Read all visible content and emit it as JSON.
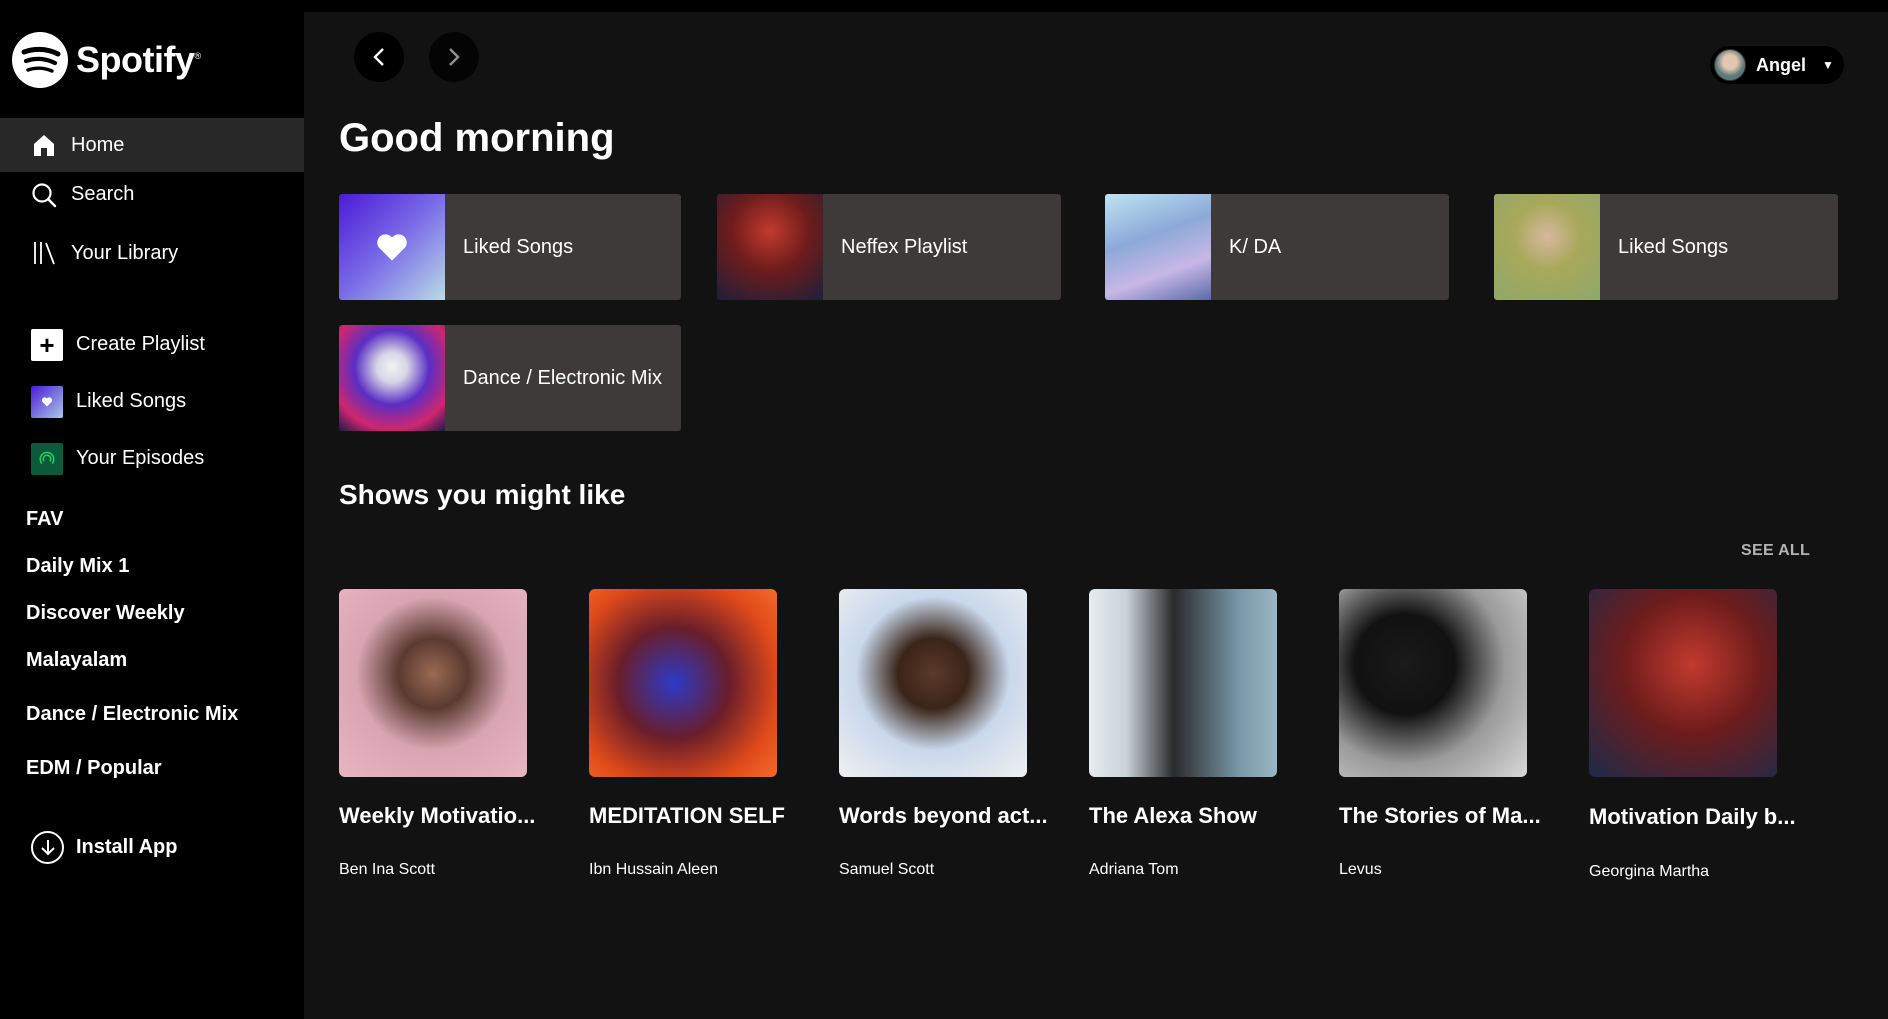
{
  "brand": {
    "name": "Spotify",
    "mark": "®"
  },
  "sidebar": {
    "nav": [
      {
        "label": "Home",
        "icon": "home-icon",
        "active": true
      },
      {
        "label": "Search",
        "icon": "search-icon"
      },
      {
        "label": "Your Library",
        "icon": "library-icon"
      }
    ],
    "actions": [
      {
        "label": "Create Playlist",
        "icon": "plus-icon"
      },
      {
        "label": "Liked Songs",
        "icon": "heart-icon"
      },
      {
        "label": "Your Episodes",
        "icon": "podcast-icon"
      }
    ],
    "playlists": [
      "FAV",
      "Daily Mix 1",
      "Discover Weekly",
      "Malayalam",
      "Dance / Electronic Mix",
      "EDM / Popular"
    ],
    "install_label": "Install App"
  },
  "header": {
    "user_name": "Angel"
  },
  "main": {
    "greeting": "Good morning",
    "quick_picks": [
      {
        "label": "Liked Songs"
      },
      {
        "label": "Neffex Playlist"
      },
      {
        "label": "K/ DA"
      },
      {
        "label": "Liked Songs"
      },
      {
        "label": "Dance / Electronic Mix"
      }
    ],
    "shows_title": "Shows you might like",
    "see_all": "SEE ALL",
    "shows": [
      {
        "title": "Weekly Motivatio...",
        "author": "Ben Ina Scott"
      },
      {
        "title": "MEDITATION SELF",
        "author": "Ibn Hussain Aleen"
      },
      {
        "title": "Words beyond act...",
        "author": "Samuel Scott"
      },
      {
        "title": "The Alexa Show",
        "author": "Adriana Tom"
      },
      {
        "title": "The Stories of Ma...",
        "author": "Levus"
      },
      {
        "title": "Motivation Daily b...",
        "author": "Georgina Martha"
      }
    ]
  },
  "colors": {
    "sidebar_bg": "#000000",
    "main_bg": "#121212",
    "card_bg": "#3e3a3a",
    "active_nav": "#282828",
    "muted_text": "#b3b3b3"
  }
}
